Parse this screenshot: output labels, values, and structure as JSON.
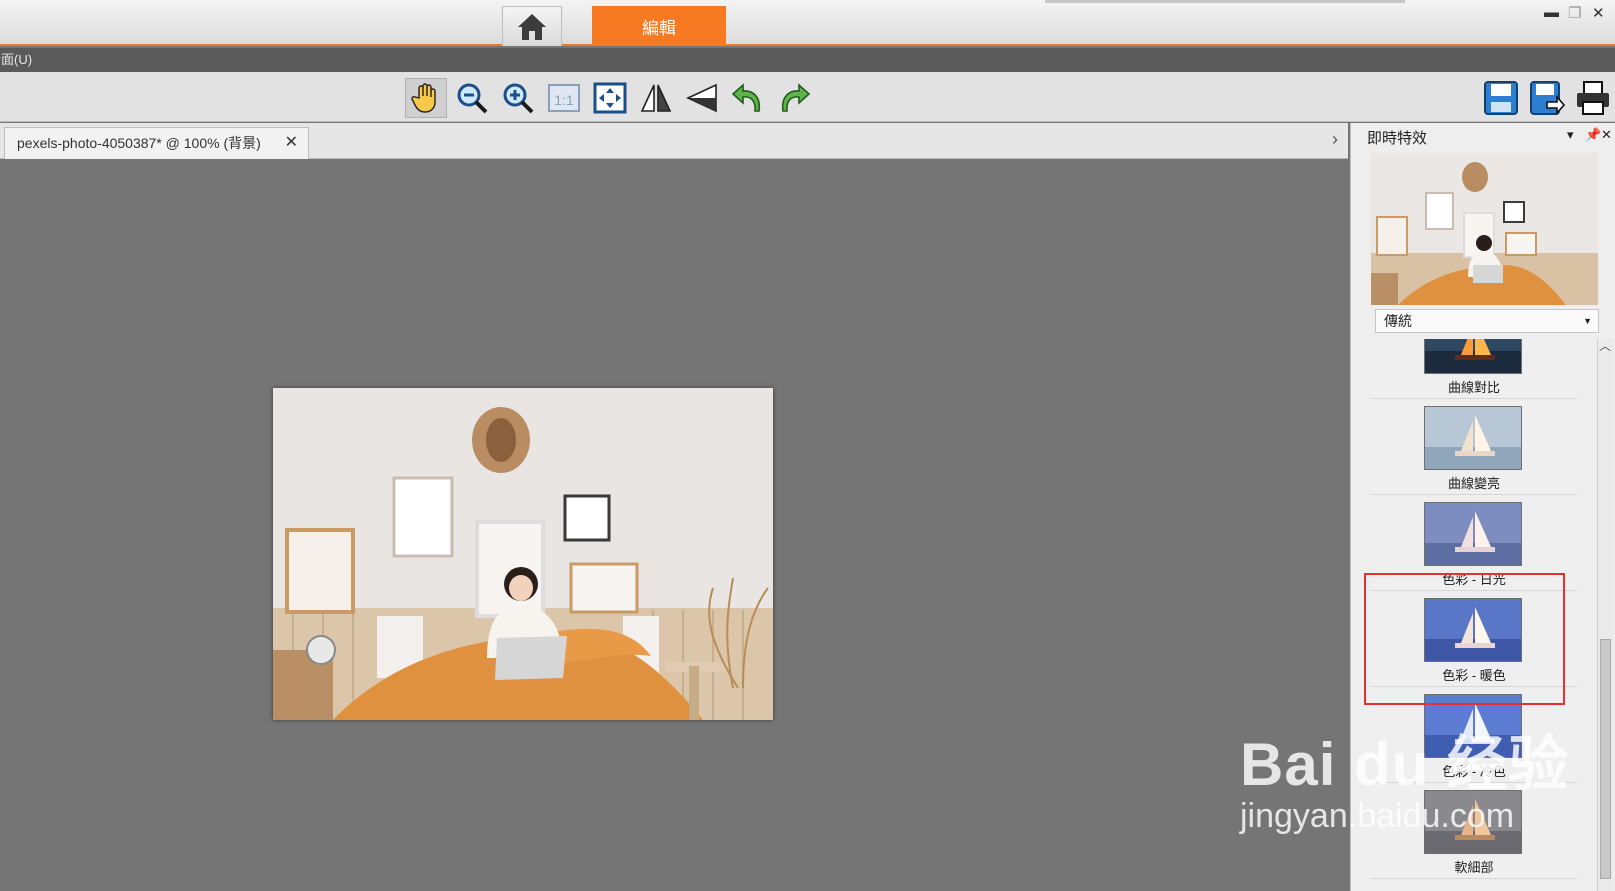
{
  "titlebar": {
    "edit_tab": "編輯",
    "accent": "#f77a22"
  },
  "menubar": {
    "label": "介面(U)"
  },
  "toolbar": {
    "tools": [
      "hand-icon",
      "zoom-out-icon",
      "zoom-in-icon",
      "actual-size-icon",
      "fit-window-icon",
      "flip-horizontal-icon",
      "flip-vertical-icon",
      "rotate-left-icon",
      "rotate-right-icon"
    ],
    "right_tools": [
      "save-icon",
      "save-as-icon",
      "print-icon"
    ],
    "actual_size_label": "1:1"
  },
  "document": {
    "tab_title": "pexels-photo-4050387* @ 100% (背景)",
    "close_label": "✕"
  },
  "panel": {
    "title": "即時特效",
    "category": "傳統",
    "effects": [
      {
        "label": "曲線對比"
      },
      {
        "label": "曲線變亮"
      },
      {
        "label": "色彩 - 日光"
      },
      {
        "label": "色彩 - 暖色"
      },
      {
        "label": "色彩 - 冷色"
      },
      {
        "label": "軟細部"
      }
    ],
    "highlighted_effect": "色彩 - 暖色",
    "highlight_color": "#e53131"
  },
  "watermark": {
    "line1": "Bai du 经验",
    "line2": "jingyan.baidu.com"
  }
}
